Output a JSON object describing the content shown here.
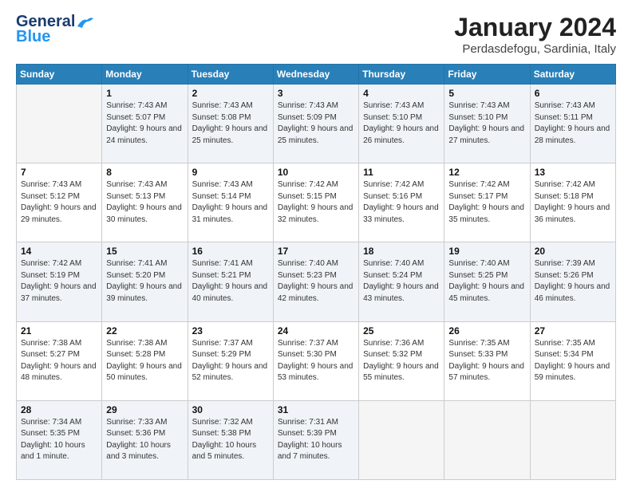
{
  "header": {
    "logo_general": "General",
    "logo_blue": "Blue",
    "title": "January 2024",
    "location": "Perdasdefogu, Sardinia, Italy"
  },
  "weekdays": [
    "Sunday",
    "Monday",
    "Tuesday",
    "Wednesday",
    "Thursday",
    "Friday",
    "Saturday"
  ],
  "weeks": [
    [
      {
        "day": "",
        "empty": true
      },
      {
        "day": "1",
        "sunrise": "Sunrise: 7:43 AM",
        "sunset": "Sunset: 5:07 PM",
        "daylight": "Daylight: 9 hours and 24 minutes."
      },
      {
        "day": "2",
        "sunrise": "Sunrise: 7:43 AM",
        "sunset": "Sunset: 5:08 PM",
        "daylight": "Daylight: 9 hours and 25 minutes."
      },
      {
        "day": "3",
        "sunrise": "Sunrise: 7:43 AM",
        "sunset": "Sunset: 5:09 PM",
        "daylight": "Daylight: 9 hours and 25 minutes."
      },
      {
        "day": "4",
        "sunrise": "Sunrise: 7:43 AM",
        "sunset": "Sunset: 5:10 PM",
        "daylight": "Daylight: 9 hours and 26 minutes."
      },
      {
        "day": "5",
        "sunrise": "Sunrise: 7:43 AM",
        "sunset": "Sunset: 5:10 PM",
        "daylight": "Daylight: 9 hours and 27 minutes."
      },
      {
        "day": "6",
        "sunrise": "Sunrise: 7:43 AM",
        "sunset": "Sunset: 5:11 PM",
        "daylight": "Daylight: 9 hours and 28 minutes."
      }
    ],
    [
      {
        "day": "7",
        "sunrise": "Sunrise: 7:43 AM",
        "sunset": "Sunset: 5:12 PM",
        "daylight": "Daylight: 9 hours and 29 minutes."
      },
      {
        "day": "8",
        "sunrise": "Sunrise: 7:43 AM",
        "sunset": "Sunset: 5:13 PM",
        "daylight": "Daylight: 9 hours and 30 minutes."
      },
      {
        "day": "9",
        "sunrise": "Sunrise: 7:43 AM",
        "sunset": "Sunset: 5:14 PM",
        "daylight": "Daylight: 9 hours and 31 minutes."
      },
      {
        "day": "10",
        "sunrise": "Sunrise: 7:42 AM",
        "sunset": "Sunset: 5:15 PM",
        "daylight": "Daylight: 9 hours and 32 minutes."
      },
      {
        "day": "11",
        "sunrise": "Sunrise: 7:42 AM",
        "sunset": "Sunset: 5:16 PM",
        "daylight": "Daylight: 9 hours and 33 minutes."
      },
      {
        "day": "12",
        "sunrise": "Sunrise: 7:42 AM",
        "sunset": "Sunset: 5:17 PM",
        "daylight": "Daylight: 9 hours and 35 minutes."
      },
      {
        "day": "13",
        "sunrise": "Sunrise: 7:42 AM",
        "sunset": "Sunset: 5:18 PM",
        "daylight": "Daylight: 9 hours and 36 minutes."
      }
    ],
    [
      {
        "day": "14",
        "sunrise": "Sunrise: 7:42 AM",
        "sunset": "Sunset: 5:19 PM",
        "daylight": "Daylight: 9 hours and 37 minutes."
      },
      {
        "day": "15",
        "sunrise": "Sunrise: 7:41 AM",
        "sunset": "Sunset: 5:20 PM",
        "daylight": "Daylight: 9 hours and 39 minutes."
      },
      {
        "day": "16",
        "sunrise": "Sunrise: 7:41 AM",
        "sunset": "Sunset: 5:21 PM",
        "daylight": "Daylight: 9 hours and 40 minutes."
      },
      {
        "day": "17",
        "sunrise": "Sunrise: 7:40 AM",
        "sunset": "Sunset: 5:23 PM",
        "daylight": "Daylight: 9 hours and 42 minutes."
      },
      {
        "day": "18",
        "sunrise": "Sunrise: 7:40 AM",
        "sunset": "Sunset: 5:24 PM",
        "daylight": "Daylight: 9 hours and 43 minutes."
      },
      {
        "day": "19",
        "sunrise": "Sunrise: 7:40 AM",
        "sunset": "Sunset: 5:25 PM",
        "daylight": "Daylight: 9 hours and 45 minutes."
      },
      {
        "day": "20",
        "sunrise": "Sunrise: 7:39 AM",
        "sunset": "Sunset: 5:26 PM",
        "daylight": "Daylight: 9 hours and 46 minutes."
      }
    ],
    [
      {
        "day": "21",
        "sunrise": "Sunrise: 7:38 AM",
        "sunset": "Sunset: 5:27 PM",
        "daylight": "Daylight: 9 hours and 48 minutes."
      },
      {
        "day": "22",
        "sunrise": "Sunrise: 7:38 AM",
        "sunset": "Sunset: 5:28 PM",
        "daylight": "Daylight: 9 hours and 50 minutes."
      },
      {
        "day": "23",
        "sunrise": "Sunrise: 7:37 AM",
        "sunset": "Sunset: 5:29 PM",
        "daylight": "Daylight: 9 hours and 52 minutes."
      },
      {
        "day": "24",
        "sunrise": "Sunrise: 7:37 AM",
        "sunset": "Sunset: 5:30 PM",
        "daylight": "Daylight: 9 hours and 53 minutes."
      },
      {
        "day": "25",
        "sunrise": "Sunrise: 7:36 AM",
        "sunset": "Sunset: 5:32 PM",
        "daylight": "Daylight: 9 hours and 55 minutes."
      },
      {
        "day": "26",
        "sunrise": "Sunrise: 7:35 AM",
        "sunset": "Sunset: 5:33 PM",
        "daylight": "Daylight: 9 hours and 57 minutes."
      },
      {
        "day": "27",
        "sunrise": "Sunrise: 7:35 AM",
        "sunset": "Sunset: 5:34 PM",
        "daylight": "Daylight: 9 hours and 59 minutes."
      }
    ],
    [
      {
        "day": "28",
        "sunrise": "Sunrise: 7:34 AM",
        "sunset": "Sunset: 5:35 PM",
        "daylight": "Daylight: 10 hours and 1 minute."
      },
      {
        "day": "29",
        "sunrise": "Sunrise: 7:33 AM",
        "sunset": "Sunset: 5:36 PM",
        "daylight": "Daylight: 10 hours and 3 minutes."
      },
      {
        "day": "30",
        "sunrise": "Sunrise: 7:32 AM",
        "sunset": "Sunset: 5:38 PM",
        "daylight": "Daylight: 10 hours and 5 minutes."
      },
      {
        "day": "31",
        "sunrise": "Sunrise: 7:31 AM",
        "sunset": "Sunset: 5:39 PM",
        "daylight": "Daylight: 10 hours and 7 minutes."
      },
      {
        "day": "",
        "empty": true
      },
      {
        "day": "",
        "empty": true
      },
      {
        "day": "",
        "empty": true
      }
    ]
  ]
}
